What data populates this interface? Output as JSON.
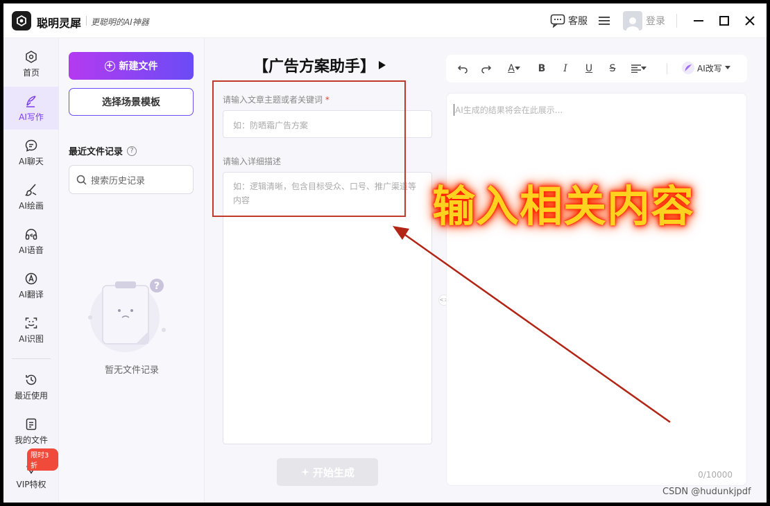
{
  "app": {
    "name": "聪明灵犀",
    "slogan": "更聪明的AI神器",
    "service_label": "客服",
    "login_label": "登录"
  },
  "nav": {
    "items": [
      {
        "label": "首页",
        "icon": "home-icon"
      },
      {
        "label": "AI写作",
        "icon": "pen-icon",
        "active": true
      },
      {
        "label": "AI聊天",
        "icon": "chat-icon"
      },
      {
        "label": "AI绘画",
        "icon": "brush-icon"
      },
      {
        "label": "AI语音",
        "icon": "headphone-icon"
      },
      {
        "label": "AI翻译",
        "icon": "translate-icon"
      },
      {
        "label": "AI识图",
        "icon": "scan-icon"
      },
      {
        "label": "最近使用",
        "icon": "clock-icon"
      },
      {
        "label": "我的文件",
        "icon": "file-icon"
      },
      {
        "label": "VIP特权",
        "icon": "diamond-icon"
      }
    ],
    "vip_badge": "限时3折"
  },
  "files": {
    "new_file": "新建文件",
    "select_template": "选择场景模板",
    "recent_title": "最近文件记录",
    "search_placeholder": "搜索历史记录",
    "empty_text": "暂无文件记录"
  },
  "form": {
    "heading": "【广告方案助手】",
    "topic_label": "请输入文章主题或者关键词",
    "required_mark": "*",
    "topic_placeholder": "如：防晒霜广告方案",
    "detail_label": "请输入详细描述",
    "detail_placeholder": "如：逻辑清晰，包含目标受众、口号、推广渠道等内容",
    "generate_button": "开始生成"
  },
  "editor": {
    "text_color_label": "A",
    "bold": "B",
    "italic": "I",
    "underline": "U",
    "strike": "S",
    "ai_rewrite": "AI改写",
    "result_placeholder": "AI生成的结果将会在此展示...",
    "counter": "0/10000"
  },
  "annotation": {
    "text": "输入相关内容",
    "color": "#ffd21f",
    "glow_color": "#ff2a00"
  },
  "watermark": "CSDN @hudunkjpdf",
  "colors": {
    "accent": "#7a3cf0",
    "gradient_start": "#b43af0",
    "gradient_end": "#6a4cf6",
    "highlight_red": "#c0392b"
  }
}
